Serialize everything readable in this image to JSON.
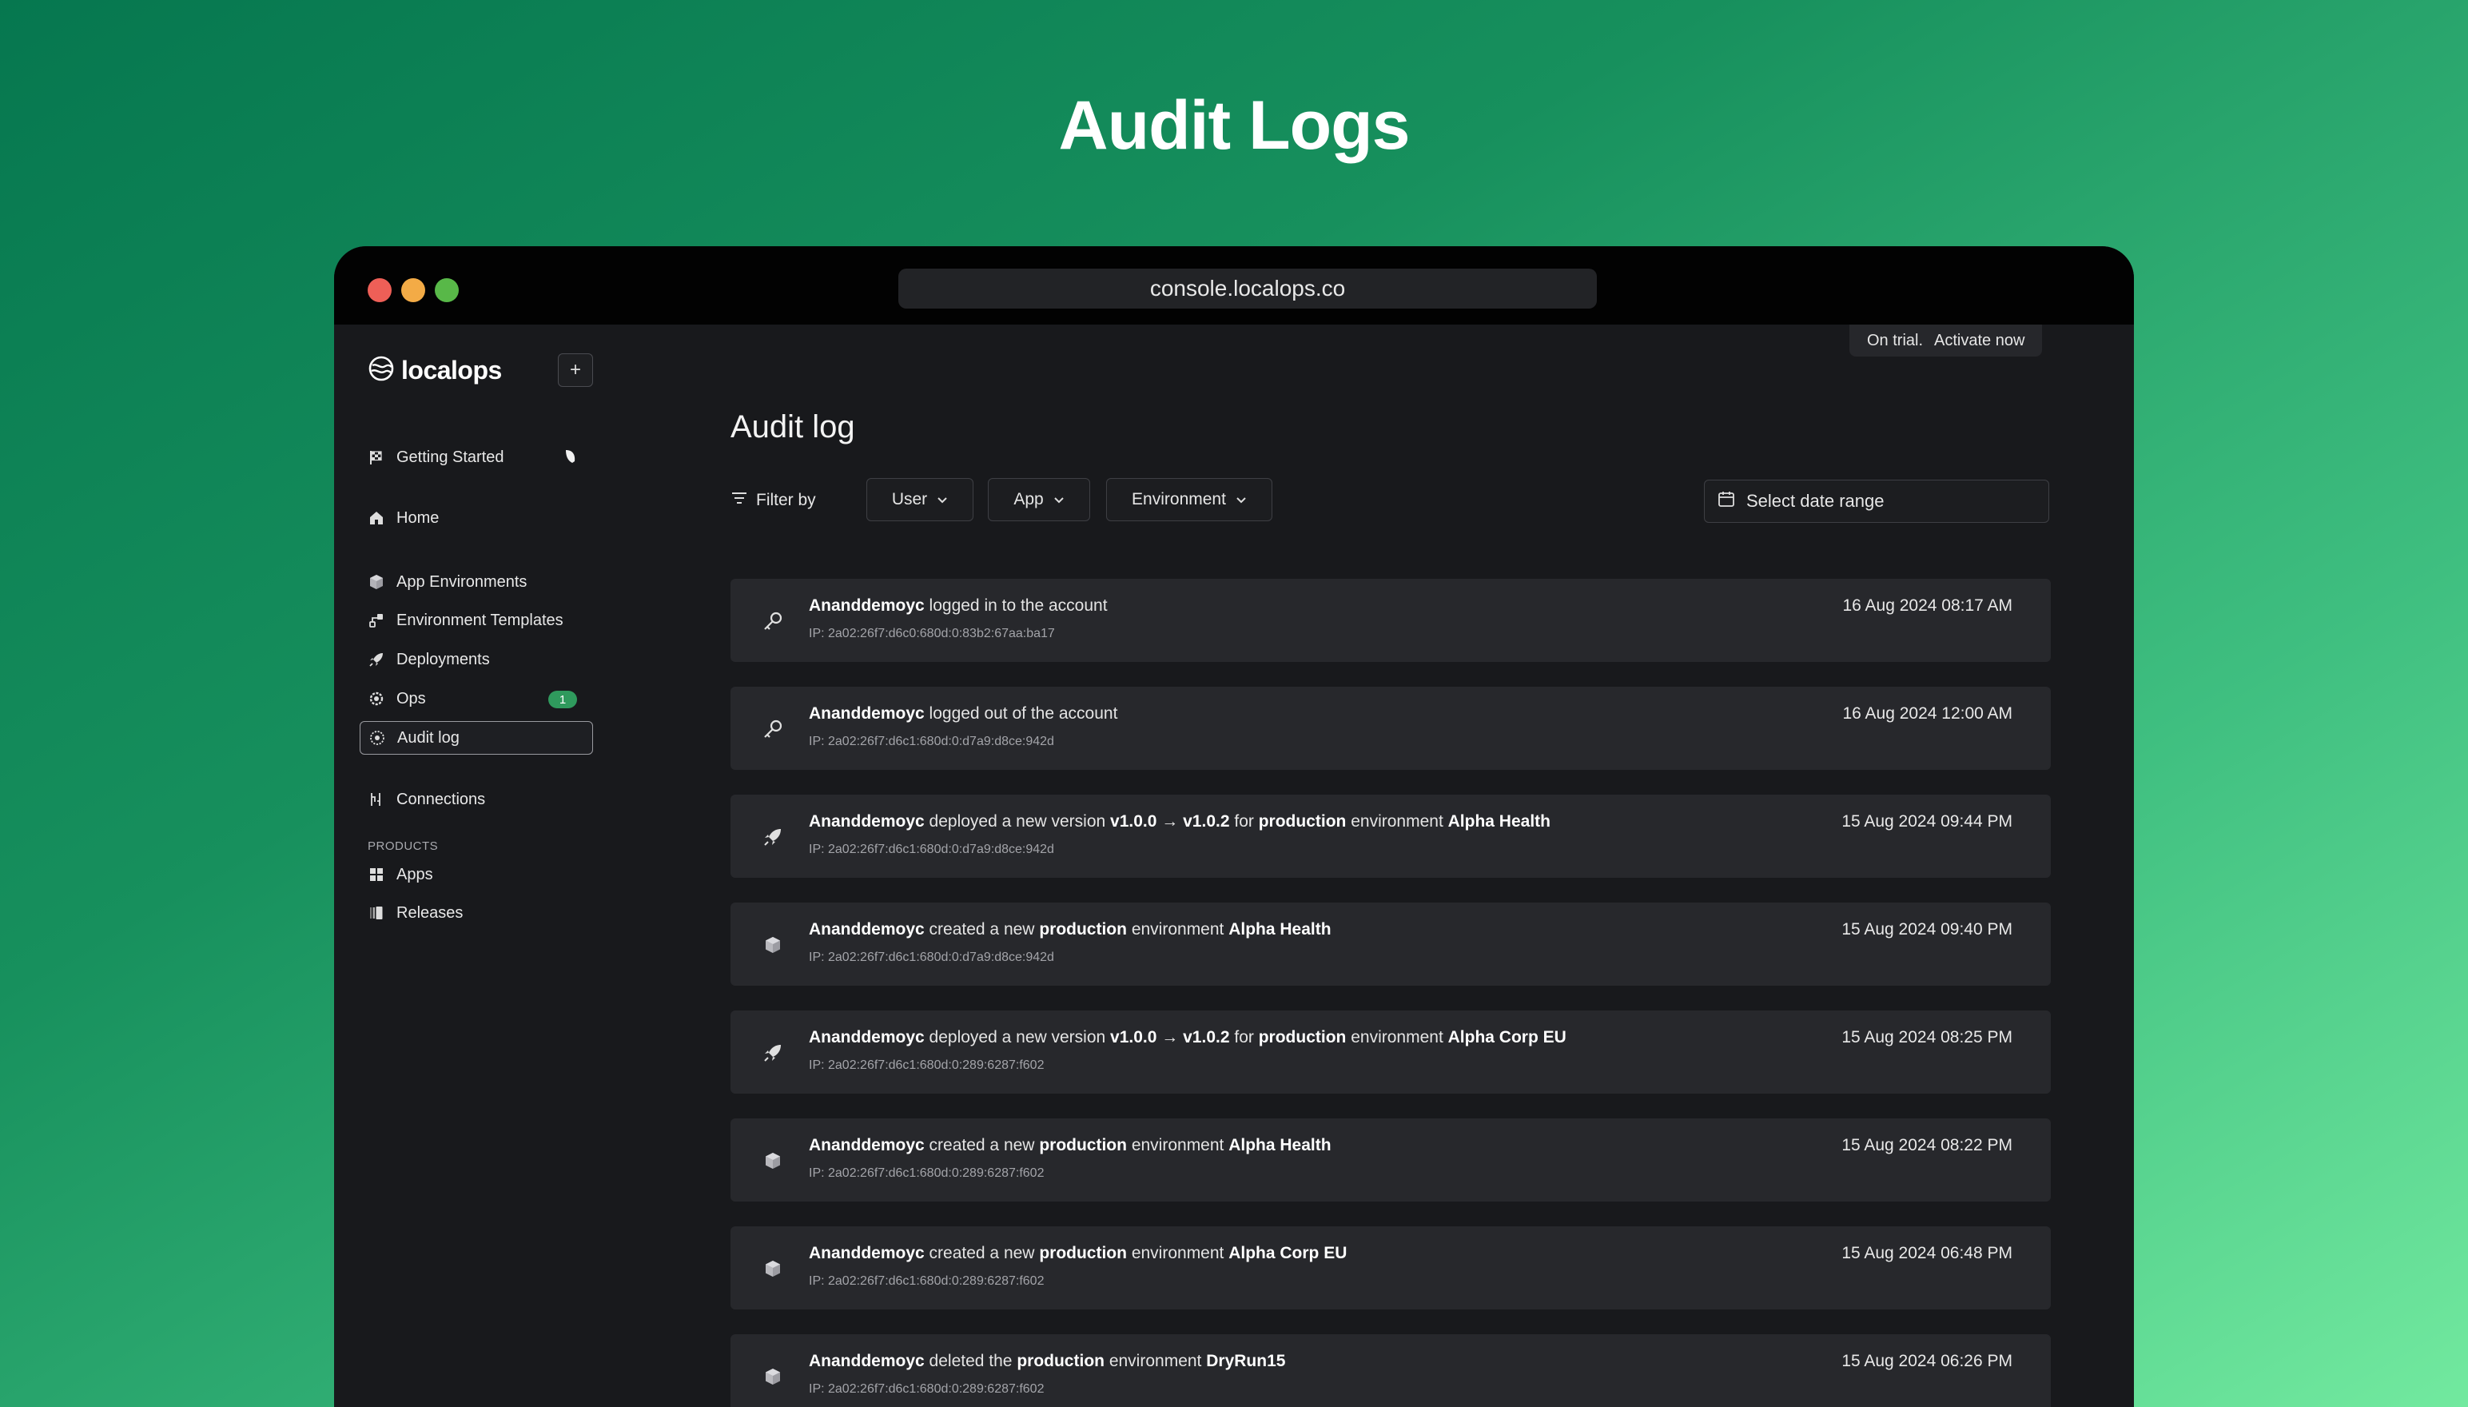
{
  "hero": {
    "title": "Audit Logs"
  },
  "browser": {
    "url": "console.localops.co"
  },
  "trial": {
    "status": "On trial.",
    "action": "Activate now"
  },
  "sidebar": {
    "logo": "localops",
    "add_label": "+",
    "items": [
      {
        "label": "Getting Started",
        "icon": "checkered-flag-icon"
      },
      {
        "label": "Home",
        "icon": "home-icon"
      },
      {
        "label": "App Environments",
        "icon": "cube-icon"
      },
      {
        "label": "Environment Templates",
        "icon": "template-icon"
      },
      {
        "label": "Deployments",
        "icon": "rocket-icon"
      },
      {
        "label": "Ops",
        "icon": "gear-icon",
        "badge": "1"
      },
      {
        "label": "Audit log",
        "icon": "audit-icon",
        "active": true
      },
      {
        "label": "Connections",
        "icon": "connections-icon"
      }
    ],
    "products_label": "PRODUCTS",
    "products": [
      {
        "label": "Apps",
        "icon": "apps-grid-icon"
      },
      {
        "label": "Releases",
        "icon": "releases-icon"
      }
    ]
  },
  "main": {
    "title": "Audit log",
    "filter_label": "Filter by",
    "filters": [
      "User",
      "App",
      "Environment"
    ],
    "date_placeholder": "Select date range",
    "logs": [
      {
        "icon": "key",
        "user": "Ananddemoyc",
        "parts": [
          [
            "logged in to the account",
            false
          ]
        ],
        "ip": "IP: 2a02:26f7:d6c0:680d:0:83b2:67aa:ba17",
        "time": "16 Aug 2024 08:17 AM"
      },
      {
        "icon": "key",
        "user": "Ananddemoyc",
        "parts": [
          [
            "logged out of the account",
            false
          ]
        ],
        "ip": "IP: 2a02:26f7:d6c1:680d:0:d7a9:d8ce:942d",
        "time": "16 Aug 2024 12:00 AM"
      },
      {
        "icon": "rocket",
        "user": "Ananddemoyc",
        "parts": [
          [
            "deployed a new version",
            false
          ],
          [
            "v1.0.0",
            true
          ],
          [
            "→",
            false
          ],
          [
            "v1.0.2",
            true
          ],
          [
            "for",
            false
          ],
          [
            "production",
            true
          ],
          [
            "environment",
            false
          ],
          [
            "Alpha Health",
            true
          ]
        ],
        "ip": "IP: 2a02:26f7:d6c1:680d:0:d7a9:d8ce:942d",
        "time": "15 Aug 2024 09:44 PM"
      },
      {
        "icon": "cube",
        "user": "Ananddemoyc",
        "parts": [
          [
            "created a new",
            false
          ],
          [
            "production",
            true
          ],
          [
            "environment",
            false
          ],
          [
            "Alpha Health",
            true
          ]
        ],
        "ip": "IP: 2a02:26f7:d6c1:680d:0:d7a9:d8ce:942d",
        "time": "15 Aug 2024 09:40 PM"
      },
      {
        "icon": "rocket",
        "user": "Ananddemoyc",
        "parts": [
          [
            "deployed a new version",
            false
          ],
          [
            "v1.0.0",
            true
          ],
          [
            "→",
            false
          ],
          [
            "v1.0.2",
            true
          ],
          [
            "for",
            false
          ],
          [
            "production",
            true
          ],
          [
            "environment",
            false
          ],
          [
            "Alpha Corp EU",
            true
          ]
        ],
        "ip": "IP: 2a02:26f7:d6c1:680d:0:289:6287:f602",
        "time": "15 Aug 2024 08:25 PM"
      },
      {
        "icon": "cube",
        "user": "Ananddemoyc",
        "parts": [
          [
            "created a new",
            false
          ],
          [
            "production",
            true
          ],
          [
            "environment",
            false
          ],
          [
            "Alpha Health",
            true
          ]
        ],
        "ip": "IP: 2a02:26f7:d6c1:680d:0:289:6287:f602",
        "time": "15 Aug 2024 08:22 PM"
      },
      {
        "icon": "cube",
        "user": "Ananddemoyc",
        "parts": [
          [
            "created a new",
            false
          ],
          [
            "production",
            true
          ],
          [
            "environment",
            false
          ],
          [
            "Alpha Corp EU",
            true
          ]
        ],
        "ip": "IP: 2a02:26f7:d6c1:680d:0:289:6287:f602",
        "time": "15 Aug 2024 06:48 PM"
      },
      {
        "icon": "cube",
        "user": "Ananddemoyc",
        "parts": [
          [
            "deleted the",
            false
          ],
          [
            "production",
            true
          ],
          [
            "environment",
            false
          ],
          [
            "DryRun15",
            true
          ]
        ],
        "ip": "IP: 2a02:26f7:d6c1:680d:0:289:6287:f602",
        "time": "15 Aug 2024 06:26 PM"
      }
    ]
  },
  "colors": {
    "accent": "#2f9a5d",
    "background_start": "#06774f",
    "background_end": "#72e99f"
  }
}
